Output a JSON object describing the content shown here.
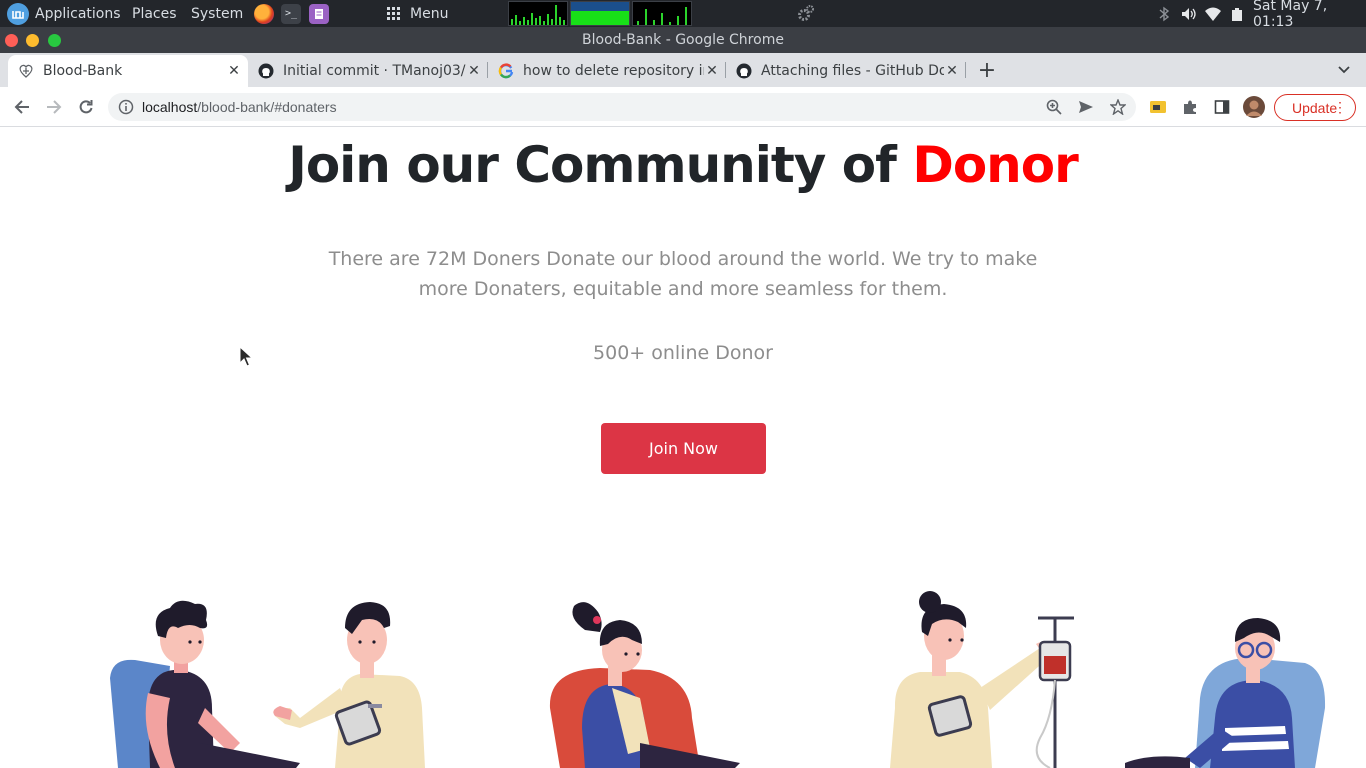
{
  "panel": {
    "menu_items": [
      "Applications",
      "Places",
      "System"
    ],
    "menu_label": "Menu",
    "clock": "Sat May 7, 01:13"
  },
  "browser": {
    "window_title": "Blood-Bank - Google Chrome",
    "tabs": [
      {
        "title": "Blood-Bank",
        "icon": "blood-bank-favicon",
        "active": true
      },
      {
        "title": "Initial commit · TManoj03/",
        "icon": "github-icon",
        "active": false
      },
      {
        "title": "how to delete repository in",
        "icon": "google-icon",
        "active": false
      },
      {
        "title": "Attaching files - GitHub Do",
        "icon": "github-icon",
        "active": false
      }
    ],
    "url_host": "localhost",
    "url_path": "/blood-bank/#donaters",
    "update_label": "Update"
  },
  "page": {
    "heading_main": "Join our Community of ",
    "heading_highlight": "Donor",
    "description": "There are 72M Doners Donate our blood around the world. We try to make more Donaters, equitable and more seamless for them.",
    "online_count": "500+ online Donor",
    "join_button": "Join Now"
  },
  "colors": {
    "accent_red": "#ff0000",
    "button_red": "#dc3545",
    "muted_text": "#8d8d8d"
  }
}
